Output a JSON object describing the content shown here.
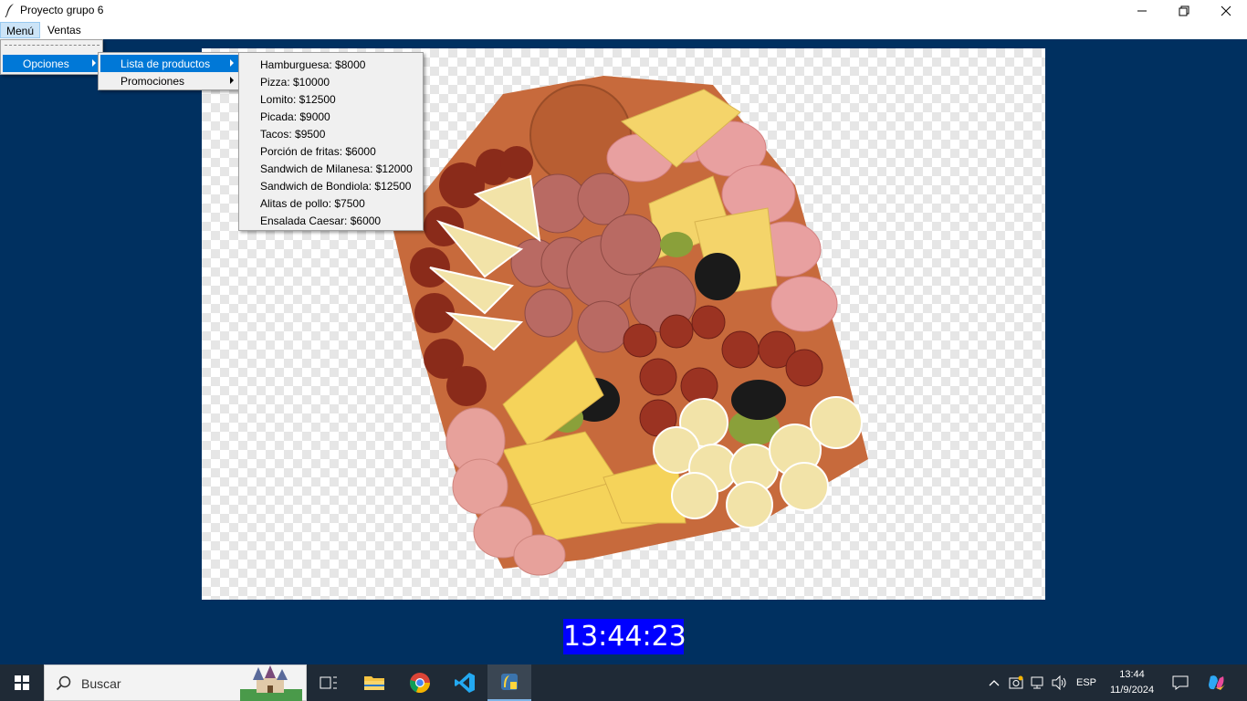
{
  "window": {
    "title": "Proyecto grupo 6"
  },
  "menubar": {
    "items": [
      "Menú",
      "Ventas"
    ]
  },
  "menu_opciones": {
    "label": "Opciones"
  },
  "submenu": {
    "items": [
      "Lista de productos",
      "Promociones"
    ]
  },
  "productos": [
    "Hamburguesa: $8000",
    "Pizza: $10000",
    "Lomito: $12500",
    "Picada: $9000",
    "Tacos: $9500",
    "Porción de fritas: $6000",
    "Sandwich de Milanesa: $12000",
    "Sandwich de Bondiola: $12500",
    "Alitas de pollo: $7500",
    "Ensalada Caesar: $6000"
  ],
  "clock": {
    "time": "13:44:23"
  },
  "taskbar": {
    "search_placeholder": "Buscar",
    "language": "ESP",
    "time": "13:44",
    "date": "11/9/2024"
  },
  "colors": {
    "background": "#003060",
    "clock_bg": "#0000ff",
    "menu_highlight": "#0078d7",
    "taskbar": "#1f2a36"
  }
}
